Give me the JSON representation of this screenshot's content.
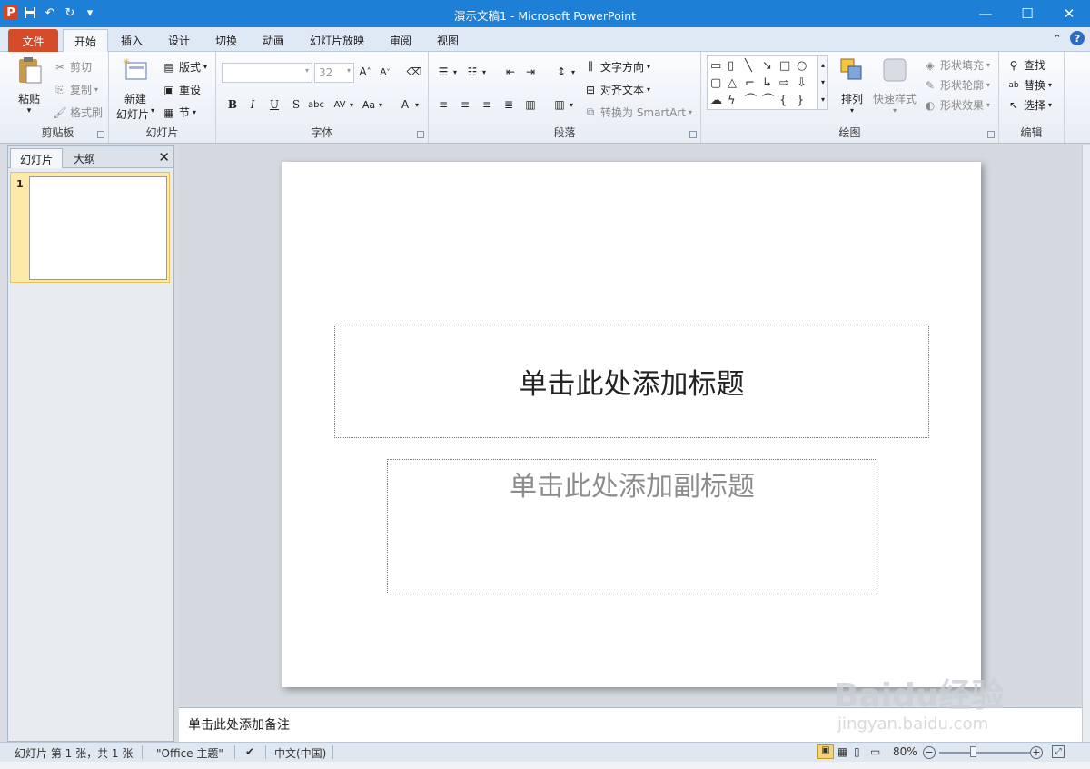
{
  "window": {
    "title": "演示文稿1 - Microsoft PowerPoint"
  },
  "qat": {
    "icons": [
      "powerpoint-logo",
      "save-icon",
      "undo-icon",
      "redo-icon",
      "customize-icon"
    ],
    "logo_letter": "P"
  },
  "tabs": [
    {
      "label": "文件"
    },
    {
      "label": "开始"
    },
    {
      "label": "插入"
    },
    {
      "label": "设计"
    },
    {
      "label": "切换"
    },
    {
      "label": "动画"
    },
    {
      "label": "幻灯片放映"
    },
    {
      "label": "审阅"
    },
    {
      "label": "视图"
    }
  ],
  "ribbon": {
    "clipboard": {
      "name": "剪贴板",
      "paste": "粘贴",
      "cut": "剪切",
      "copy": "复制",
      "format_painter": "格式刷"
    },
    "slides": {
      "name": "幻灯片",
      "new_slide_1": "新建",
      "new_slide_2": "幻灯片",
      "layout": "版式",
      "reset": "重设",
      "section": "节"
    },
    "font": {
      "name": "字体",
      "size": "32"
    },
    "paragraph": {
      "name": "段落",
      "text_direction": "文字方向",
      "align_text": "对齐文本",
      "smartart": "转换为 SmartArt"
    },
    "drawing": {
      "name": "绘图",
      "arrange": "排列",
      "quick_styles": "快速样式",
      "fill": "形状填充",
      "outline": "形状轮廓",
      "effects": "形状效果"
    },
    "editing": {
      "name": "编辑",
      "find": "查找",
      "replace": "替换",
      "select": "选择"
    }
  },
  "pane": {
    "tab_slides": "幻灯片",
    "tab_outline": "大纲",
    "slide_number": "1"
  },
  "slide": {
    "title_placeholder": "单击此处添加标题",
    "subtitle_placeholder": "单击此处添加副标题"
  },
  "notes": {
    "placeholder": "单击此处添加备注"
  },
  "status": {
    "slide_info": "幻灯片 第 1 张，共 1 张",
    "theme": "\"Office 主题\"",
    "language": "中文(中国)",
    "zoom": "80%"
  },
  "watermark": {
    "text": "Baidu经验",
    "sub": "jingyan.baidu.com"
  },
  "colors": {
    "titlebar": "#1d7fd6",
    "file_tab": "#d64c2a",
    "selected_thumb": "#fde9a8"
  }
}
